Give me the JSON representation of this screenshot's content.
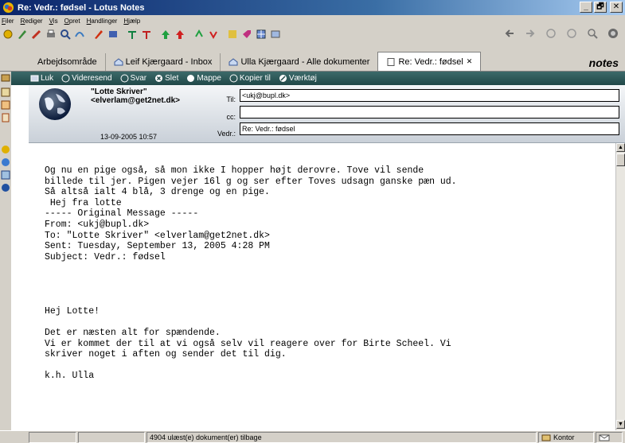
{
  "window": {
    "title": "Re: Vedr.: fødsel - Lotus Notes",
    "minimize": "_",
    "maximize": "🗗",
    "close": "✕"
  },
  "menu": [
    "Filer",
    "Rediger",
    "Vis",
    "Opret",
    "Handlinger",
    "Hjælp"
  ],
  "tabs": [
    {
      "label": "Arbejdsområde"
    },
    {
      "label": "Leif Kjærgaard - Inbox"
    },
    {
      "label": "Ulla Kjærgaard - Alle dokumenter"
    },
    {
      "label": "Re: Vedr.: fødsel",
      "close": "✕"
    }
  ],
  "brand": "notes",
  "actions": [
    "Luk",
    "Videresend",
    "Svar",
    "Slet",
    "Mappe",
    "Kopier til",
    "Værktøj"
  ],
  "memo": {
    "sender_name": "\"Lotte Skriver\"",
    "sender_email": "<elverlam@get2net.dk>",
    "date": "13-09-2005 10:57",
    "to_label": "Til:",
    "to_value": "<ukj@bupl.dk>",
    "cc_label": "cc:",
    "cc_value": "",
    "subject_label": "Vedr.:",
    "subject_value": "Re: Vedr.: fødsel"
  },
  "body": "Og nu en pige også, så mon ikke I hopper højt derovre. Tove vil sende\nbillede til jer. Pigen vejer 16l g og ser efter Toves udsagn ganske pæn ud.\nSå altså ialt 4 blå, 3 drenge og en pige.\n Hej fra lotte\n----- Original Message -----\nFrom: <ukj@bupl.dk>\nTo: \"Lotte Skriver\" <elverlam@get2net.dk>\nSent: Tuesday, September 13, 2005 4:28 PM\nSubject: Vedr.: fødsel\n\n\n\n\nHej Lotte!\n\nDet er næsten alt for spændende.\nVi er kommet der til at vi også selv vil reagere over for Birte Scheel. Vi\nskriver noget i aften og sender det til dig.\n\nk.h. Ulla",
  "status": {
    "unread": "4904 ulæst(e) dokument(er) tilbage",
    "location": "Kontor"
  },
  "colors": {
    "titlebar": "#0a246a",
    "actionbar": "#3c6a6a",
    "chrome": "#d4d0c8"
  }
}
